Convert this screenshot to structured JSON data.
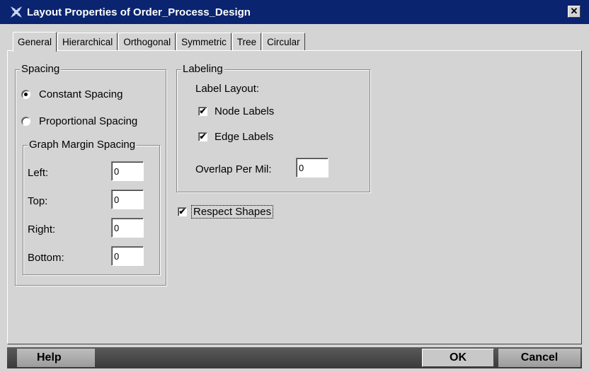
{
  "window": {
    "title": "Layout Properties of Order_Process_Design",
    "close_glyph": "✕"
  },
  "tabs": [
    {
      "label": "General",
      "active": true
    },
    {
      "label": "Hierarchical"
    },
    {
      "label": "Orthogonal"
    },
    {
      "label": "Symmetric"
    },
    {
      "label": "Tree"
    },
    {
      "label": "Circular"
    }
  ],
  "spacing": {
    "title": "Spacing",
    "constant": {
      "label": "Constant Spacing",
      "selected": true
    },
    "proportional": {
      "label": "Proportional Spacing",
      "selected": false
    },
    "margin": {
      "title": "Graph Margin Spacing",
      "left": {
        "label": "Left:",
        "value": "0"
      },
      "top": {
        "label": "Top:",
        "value": "0"
      },
      "right": {
        "label": "Right:",
        "value": "0"
      },
      "bottom": {
        "label": "Bottom:",
        "value": "0"
      }
    }
  },
  "labeling": {
    "title": "Labeling",
    "label_layout": "Label Layout:",
    "node_labels": {
      "label": "Node Labels",
      "checked": true
    },
    "edge_labels": {
      "label": "Edge Labels",
      "checked": true
    },
    "overlap": {
      "label": "Overlap Per Mil:",
      "value": "0"
    }
  },
  "respect_shapes": {
    "label": "Respect Shapes",
    "checked": true
  },
  "buttons": {
    "help": "Help",
    "ok": "OK",
    "cancel": "Cancel"
  },
  "check_glyph": "✔",
  "colors": {
    "titlebar": "#0a2470",
    "dialog": "#d4d4d4",
    "buttonbar": "#4a4a4a"
  }
}
